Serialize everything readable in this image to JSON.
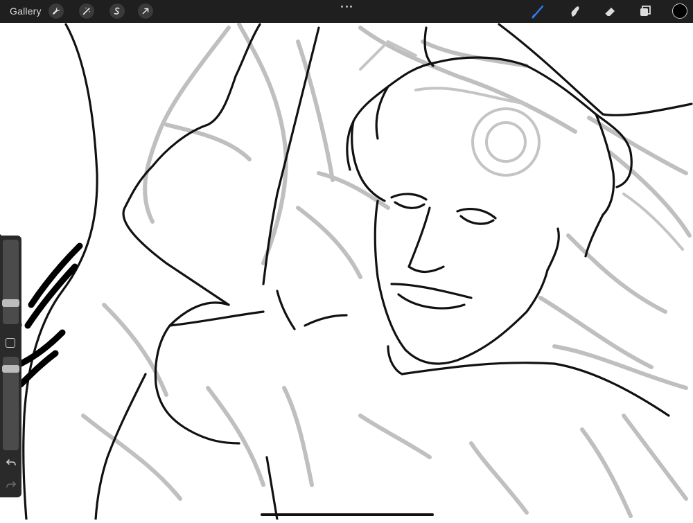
{
  "topbar": {
    "gallery_label": "Gallery",
    "left_tools": [
      {
        "icon": "wrench-icon",
        "name": "actions"
      },
      {
        "icon": "magic-wand-icon",
        "name": "adjustments"
      },
      {
        "icon": "selection-s-icon",
        "name": "selection"
      },
      {
        "icon": "arrow-cursor-icon",
        "name": "transform"
      }
    ],
    "right_tools": [
      {
        "icon": "brush-icon",
        "name": "paint",
        "active": true
      },
      {
        "icon": "smudge-icon",
        "name": "smudge"
      },
      {
        "icon": "eraser-icon",
        "name": "erase"
      },
      {
        "icon": "layers-icon",
        "name": "layers"
      }
    ],
    "active_tool_color": "#2f7cf6",
    "current_color": "#000000"
  },
  "sidebar": {
    "brush_size_level": 0.28,
    "opacity_level": 0.85,
    "buttons": [
      "undo-icon",
      "redo-icon"
    ]
  },
  "canvas": {
    "subject": "sketch-artwork"
  }
}
